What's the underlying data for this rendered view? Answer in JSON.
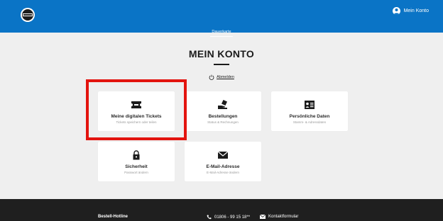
{
  "header": {
    "account_label": "Mein Konto",
    "subnav_label": "Dauerkarte"
  },
  "main": {
    "title": "MEIN KONTO",
    "logout_label": "Abmelden"
  },
  "cards": [
    {
      "title": "Meine digitalen Tickets",
      "subtitle": "Tickets speichern oder teilen",
      "icon": "ticket-icon"
    },
    {
      "title": "Bestellungen",
      "subtitle": "Status & Rechnungen",
      "icon": "order-hand-icon"
    },
    {
      "title": "Persönliche Daten",
      "subtitle": "Stamm- & Adressdaten",
      "icon": "id-card-icon"
    },
    {
      "title": "Sicherheit",
      "subtitle": "Passwort ändern",
      "icon": "lock-icon"
    },
    {
      "title": "E-Mail-Adresse",
      "subtitle": "E-Mail-Adresse ändern",
      "icon": "envelope-icon"
    }
  ],
  "footer": {
    "hotline_label": "Bestell-Hotline",
    "phone": "01806 - 99 15 18**",
    "contact_label": "Kontaktformular"
  },
  "colors": {
    "brand_blue": "#0a74c6",
    "highlight_red": "#e3140f",
    "footer_bg": "#1f1f1f",
    "page_bg": "#efefef"
  }
}
